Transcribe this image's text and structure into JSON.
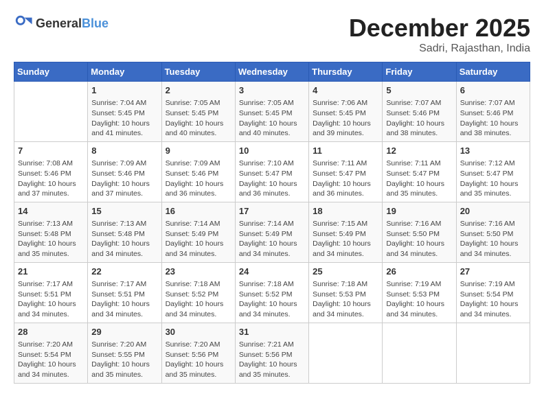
{
  "header": {
    "logo_general": "General",
    "logo_blue": "Blue",
    "month": "December 2025",
    "location": "Sadri, Rajasthan, India"
  },
  "days_of_week": [
    "Sunday",
    "Monday",
    "Tuesday",
    "Wednesday",
    "Thursday",
    "Friday",
    "Saturday"
  ],
  "weeks": [
    [
      {
        "day": "",
        "sunrise": "",
        "sunset": "",
        "daylight": ""
      },
      {
        "day": "1",
        "sunrise": "Sunrise: 7:04 AM",
        "sunset": "Sunset: 5:45 PM",
        "daylight": "Daylight: 10 hours and 41 minutes."
      },
      {
        "day": "2",
        "sunrise": "Sunrise: 7:05 AM",
        "sunset": "Sunset: 5:45 PM",
        "daylight": "Daylight: 10 hours and 40 minutes."
      },
      {
        "day": "3",
        "sunrise": "Sunrise: 7:05 AM",
        "sunset": "Sunset: 5:45 PM",
        "daylight": "Daylight: 10 hours and 40 minutes."
      },
      {
        "day": "4",
        "sunrise": "Sunrise: 7:06 AM",
        "sunset": "Sunset: 5:45 PM",
        "daylight": "Daylight: 10 hours and 39 minutes."
      },
      {
        "day": "5",
        "sunrise": "Sunrise: 7:07 AM",
        "sunset": "Sunset: 5:46 PM",
        "daylight": "Daylight: 10 hours and 38 minutes."
      },
      {
        "day": "6",
        "sunrise": "Sunrise: 7:07 AM",
        "sunset": "Sunset: 5:46 PM",
        "daylight": "Daylight: 10 hours and 38 minutes."
      }
    ],
    [
      {
        "day": "7",
        "sunrise": "Sunrise: 7:08 AM",
        "sunset": "Sunset: 5:46 PM",
        "daylight": "Daylight: 10 hours and 37 minutes."
      },
      {
        "day": "8",
        "sunrise": "Sunrise: 7:09 AM",
        "sunset": "Sunset: 5:46 PM",
        "daylight": "Daylight: 10 hours and 37 minutes."
      },
      {
        "day": "9",
        "sunrise": "Sunrise: 7:09 AM",
        "sunset": "Sunset: 5:46 PM",
        "daylight": "Daylight: 10 hours and 36 minutes."
      },
      {
        "day": "10",
        "sunrise": "Sunrise: 7:10 AM",
        "sunset": "Sunset: 5:47 PM",
        "daylight": "Daylight: 10 hours and 36 minutes."
      },
      {
        "day": "11",
        "sunrise": "Sunrise: 7:11 AM",
        "sunset": "Sunset: 5:47 PM",
        "daylight": "Daylight: 10 hours and 36 minutes."
      },
      {
        "day": "12",
        "sunrise": "Sunrise: 7:11 AM",
        "sunset": "Sunset: 5:47 PM",
        "daylight": "Daylight: 10 hours and 35 minutes."
      },
      {
        "day": "13",
        "sunrise": "Sunrise: 7:12 AM",
        "sunset": "Sunset: 5:47 PM",
        "daylight": "Daylight: 10 hours and 35 minutes."
      }
    ],
    [
      {
        "day": "14",
        "sunrise": "Sunrise: 7:13 AM",
        "sunset": "Sunset: 5:48 PM",
        "daylight": "Daylight: 10 hours and 35 minutes."
      },
      {
        "day": "15",
        "sunrise": "Sunrise: 7:13 AM",
        "sunset": "Sunset: 5:48 PM",
        "daylight": "Daylight: 10 hours and 34 minutes."
      },
      {
        "day": "16",
        "sunrise": "Sunrise: 7:14 AM",
        "sunset": "Sunset: 5:49 PM",
        "daylight": "Daylight: 10 hours and 34 minutes."
      },
      {
        "day": "17",
        "sunrise": "Sunrise: 7:14 AM",
        "sunset": "Sunset: 5:49 PM",
        "daylight": "Daylight: 10 hours and 34 minutes."
      },
      {
        "day": "18",
        "sunrise": "Sunrise: 7:15 AM",
        "sunset": "Sunset: 5:49 PM",
        "daylight": "Daylight: 10 hours and 34 minutes."
      },
      {
        "day": "19",
        "sunrise": "Sunrise: 7:16 AM",
        "sunset": "Sunset: 5:50 PM",
        "daylight": "Daylight: 10 hours and 34 minutes."
      },
      {
        "day": "20",
        "sunrise": "Sunrise: 7:16 AM",
        "sunset": "Sunset: 5:50 PM",
        "daylight": "Daylight: 10 hours and 34 minutes."
      }
    ],
    [
      {
        "day": "21",
        "sunrise": "Sunrise: 7:17 AM",
        "sunset": "Sunset: 5:51 PM",
        "daylight": "Daylight: 10 hours and 34 minutes."
      },
      {
        "day": "22",
        "sunrise": "Sunrise: 7:17 AM",
        "sunset": "Sunset: 5:51 PM",
        "daylight": "Daylight: 10 hours and 34 minutes."
      },
      {
        "day": "23",
        "sunrise": "Sunrise: 7:18 AM",
        "sunset": "Sunset: 5:52 PM",
        "daylight": "Daylight: 10 hours and 34 minutes."
      },
      {
        "day": "24",
        "sunrise": "Sunrise: 7:18 AM",
        "sunset": "Sunset: 5:52 PM",
        "daylight": "Daylight: 10 hours and 34 minutes."
      },
      {
        "day": "25",
        "sunrise": "Sunrise: 7:18 AM",
        "sunset": "Sunset: 5:53 PM",
        "daylight": "Daylight: 10 hours and 34 minutes."
      },
      {
        "day": "26",
        "sunrise": "Sunrise: 7:19 AM",
        "sunset": "Sunset: 5:53 PM",
        "daylight": "Daylight: 10 hours and 34 minutes."
      },
      {
        "day": "27",
        "sunrise": "Sunrise: 7:19 AM",
        "sunset": "Sunset: 5:54 PM",
        "daylight": "Daylight: 10 hours and 34 minutes."
      }
    ],
    [
      {
        "day": "28",
        "sunrise": "Sunrise: 7:20 AM",
        "sunset": "Sunset: 5:54 PM",
        "daylight": "Daylight: 10 hours and 34 minutes."
      },
      {
        "day": "29",
        "sunrise": "Sunrise: 7:20 AM",
        "sunset": "Sunset: 5:55 PM",
        "daylight": "Daylight: 10 hours and 35 minutes."
      },
      {
        "day": "30",
        "sunrise": "Sunrise: 7:20 AM",
        "sunset": "Sunset: 5:56 PM",
        "daylight": "Daylight: 10 hours and 35 minutes."
      },
      {
        "day": "31",
        "sunrise": "Sunrise: 7:21 AM",
        "sunset": "Sunset: 5:56 PM",
        "daylight": "Daylight: 10 hours and 35 minutes."
      },
      {
        "day": "",
        "sunrise": "",
        "sunset": "",
        "daylight": ""
      },
      {
        "day": "",
        "sunrise": "",
        "sunset": "",
        "daylight": ""
      },
      {
        "day": "",
        "sunrise": "",
        "sunset": "",
        "daylight": ""
      }
    ]
  ]
}
